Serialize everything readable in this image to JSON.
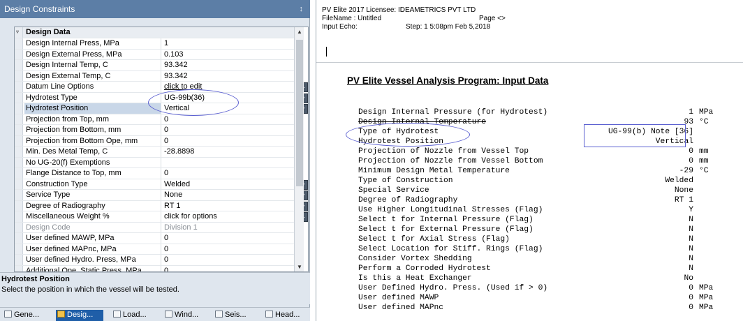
{
  "left_panel": {
    "title": "Design Constraints",
    "pin_glyph": "↕",
    "category": "Design Data",
    "rows": [
      {
        "name": "Design Internal Press, MPa",
        "value": "1"
      },
      {
        "name": "Design External Press, MPa",
        "value": "0.103"
      },
      {
        "name": "Design Internal Temp, C",
        "value": "93.342"
      },
      {
        "name": "Design External Temp, C",
        "value": "93.342"
      },
      {
        "name": "Datum Line Options",
        "value": "click to edit"
      },
      {
        "name": "Hydrotest Type",
        "value": "UG-99b(36)"
      },
      {
        "name": "Hydrotest Position",
        "value": "Vertical"
      },
      {
        "name": "Projection from Top, mm",
        "value": "0"
      },
      {
        "name": "Projection from Bottom, mm",
        "value": "0"
      },
      {
        "name": "Projection from Bottom Ope, mm",
        "value": "0"
      },
      {
        "name": "Min. Des Metal Temp, C",
        "value": "-28.8898"
      },
      {
        "name": "No UG-20(f) Exemptions",
        "value": ""
      },
      {
        "name": "Flange Distance to Top, mm",
        "value": "0"
      },
      {
        "name": "Construction Type",
        "value": "Welded"
      },
      {
        "name": "Service Type",
        "value": "None"
      },
      {
        "name": "Degree of Radiography",
        "value": "RT 1"
      },
      {
        "name": "Miscellaneous Weight %",
        "value": "click for options"
      },
      {
        "name": "Design Code",
        "value": "Division 1"
      },
      {
        "name": "User defined MAWP, MPa",
        "value": "0"
      },
      {
        "name": "User defined MAPnc, MPa",
        "value": "0"
      },
      {
        "name": "User defined Hydro. Press, MPa",
        "value": "0"
      },
      {
        "name": "Additional Ope. Static Press, MPa",
        "value": "0"
      }
    ],
    "help": {
      "title": "Hydrotest Position",
      "text": "Select the position in which the vessel will be tested."
    },
    "tabs": [
      "Gene...",
      "Desig...",
      "Load...",
      "Wind...",
      "Seis...",
      "Head..."
    ]
  },
  "right_panel": {
    "header": {
      "line1": "PV Elite 2017   Licensee: IDEAMETRICS PVT LTD",
      "line2_left": "FileName : Untitled",
      "line2_right": "Page <>",
      "line3_left": "Input Echo:",
      "line3_step": "Step:   1   5:08pm   Feb 5,2018"
    },
    "program_title": "PV Elite Vessel Analysis Program: Input Data",
    "rows": [
      {
        "label": "Design Internal Pressure (for Hydrotest)",
        "value": "1",
        "unit": "MPa"
      },
      {
        "label": "Design Internal Temperature",
        "value": "93",
        "unit": "°C"
      },
      {
        "label": "Type of Hydrotest",
        "value": "UG-99(b) Note [36]",
        "unit": ""
      },
      {
        "label": "Hydrotest Position",
        "value": "Vertical",
        "unit": ""
      },
      {
        "label": "Projection of Nozzle from Vessel Top",
        "value": "0",
        "unit": "mm"
      },
      {
        "label": "Projection of Nozzle from Vessel Bottom",
        "value": "0",
        "unit": "mm"
      },
      {
        "label": "Minimum Design Metal Temperature",
        "value": "-29",
        "unit": "°C"
      },
      {
        "label": "Type of Construction",
        "value": "Welded",
        "unit": ""
      },
      {
        "label": "Special Service",
        "value": "None",
        "unit": ""
      },
      {
        "label": "Degree of Radiography",
        "value": "RT 1",
        "unit": ""
      },
      {
        "label": "Use Higher Longitudinal Stresses (Flag)",
        "value": "Y",
        "unit": ""
      },
      {
        "label": "Select t for Internal Pressure (Flag)",
        "value": "N",
        "unit": ""
      },
      {
        "label": "Select t for External Pressure (Flag)",
        "value": "N",
        "unit": ""
      },
      {
        "label": "Select t for Axial Stress (Flag)",
        "value": "N",
        "unit": ""
      },
      {
        "label": "Select Location for Stiff. Rings (Flag)",
        "value": "N",
        "unit": ""
      },
      {
        "label": "Consider Vortex Shedding",
        "value": "N",
        "unit": ""
      },
      {
        "label": "Perform a Corroded Hydrotest",
        "value": "N",
        "unit": ""
      },
      {
        "label": "Is this a Heat Exchanger",
        "value": "No",
        "unit": ""
      },
      {
        "label": "User Defined Hydro. Press. (Used if > 0)",
        "value": "0",
        "unit": "MPa"
      },
      {
        "label": "User defined MAWP",
        "value": "0",
        "unit": "MPa"
      },
      {
        "label": "User defined MAPnc",
        "value": "0",
        "unit": "MPa"
      }
    ]
  },
  "colors": {
    "title_bar": "#5c7ea6",
    "selected_tab": "#1f5ea8",
    "annotation": "#5a5fd0"
  }
}
